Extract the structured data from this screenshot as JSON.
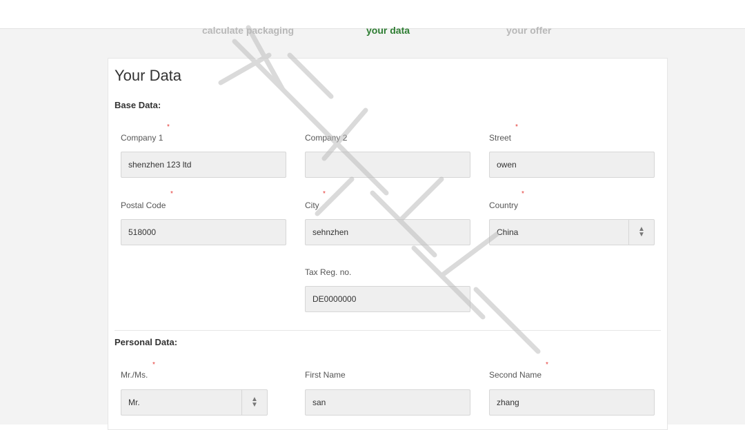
{
  "steps": [
    "calculate packaging",
    "your data",
    "your offer"
  ],
  "card": {
    "title": "Your Data"
  },
  "base": {
    "title": "Base Data:",
    "company1": {
      "label": "Company 1",
      "value": "shenzhen 123 ltd"
    },
    "company2": {
      "label": "Company 2",
      "value": ""
    },
    "street": {
      "label": "Street",
      "value": "owen"
    },
    "postal": {
      "label": "Postal Code",
      "value": "518000"
    },
    "city": {
      "label": "City",
      "value": "sehnzhen"
    },
    "country": {
      "label": "Country",
      "value": "China"
    },
    "tax": {
      "label": "Tax Reg. no.",
      "value": "DE0000000"
    }
  },
  "personal": {
    "title": "Personal Data:",
    "salutation": {
      "label": "Mr./Ms.",
      "value": "Mr."
    },
    "first_name": {
      "label": "First Name",
      "value": "san"
    },
    "second_name": {
      "label": "Second Name",
      "value": "zhang"
    }
  },
  "colors": {
    "active_step": "#2e7d32",
    "required": "#e53935",
    "inactive_step": "#b8b8b8"
  },
  "icons": {
    "select": "chevron-updown-icon"
  }
}
